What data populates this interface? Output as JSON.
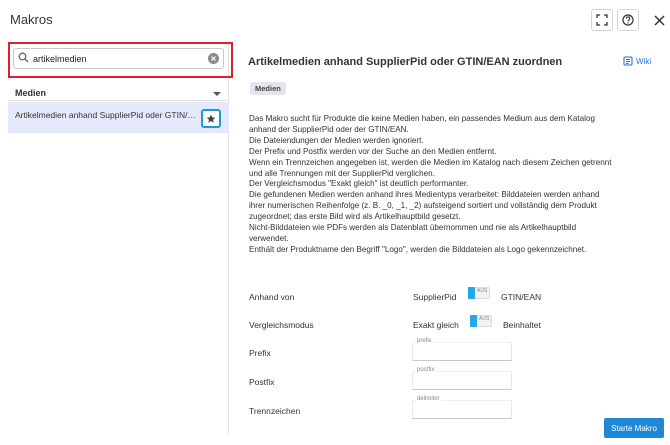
{
  "window": {
    "title": "Makros"
  },
  "sidebar": {
    "search": {
      "value": "artikelmedien",
      "placeholder": ""
    },
    "group": {
      "label": "Medien"
    },
    "items": [
      {
        "label": "Artikelmedien anhand SupplierPid oder GTIN/EAN zuordnen"
      }
    ]
  },
  "main": {
    "title": "Artikelmedien anhand SupplierPid oder GTIN/EAN zuordnen",
    "wiki_label": "Wiki",
    "tag": "Medien",
    "description": [
      "Das Makro sucht für Produkte die keine Medien haben, ein passendes Medium aus dem Katalog",
      "anhand der SupplierPid oder der GTIN/EAN.",
      "Die Dateiendungen der Medien werden ignoriert.",
      "Der Prefix und Postfix werden vor der Suche an den Medien entfernt.",
      "Wenn ein Trennzeichen angegeben ist, werden die Medien im Katalog nach diesem Zeichen getrennt",
      "und alle Trennungen mit der SupplierPid verglichen.",
      "Der Vergleichsmodus \"Exakt gleich\" ist deutlich performanter.",
      "Die gefundenen Medien werden anhand ihres Medientyps verarbeitet: Bilddateien werden anhand",
      "ihrer numerischen Reihenfolge (z. B. _0, _1, _2) aufsteigend sortiert und vollständig dem Produkt",
      "zugeordnet; das erste Bild wird als Artikelhauptbild gesetzt.",
      "Nicht-Bilddateien wie PDFs werden als Datenblatt übernommen und nie als Artikelhauptbild",
      "verwendet.",
      "Enthält der Produktname den Begriff \"Logo\", werden die Bilddateien als Logo gekennzeichnet."
    ],
    "fields": {
      "anhand_von": {
        "label": "Anhand von",
        "option_left": "SupplierPid",
        "toggle_label": "AUS",
        "option_right": "GTIN/EAN"
      },
      "vergleichsmodus": {
        "label": "Vergleichsmodus",
        "option_left": "Exakt gleich",
        "toggle_label": "AUS",
        "option_right": "Beinhaltet"
      },
      "prefix": {
        "label": "Prefix",
        "placeholder": "prefix",
        "value": ""
      },
      "postfix": {
        "label": "Postfix",
        "placeholder": "postfix",
        "value": ""
      },
      "trennzeichen": {
        "label": "Trennzeichen",
        "placeholder": "delimiter",
        "value": ""
      }
    },
    "start_button": "Starte Makro"
  },
  "colors": {
    "accent": "#1e88d6",
    "highlight_outline": "#e0202c",
    "selected_row": "#e6e9fb",
    "toggle_on": "#25a8e8"
  }
}
